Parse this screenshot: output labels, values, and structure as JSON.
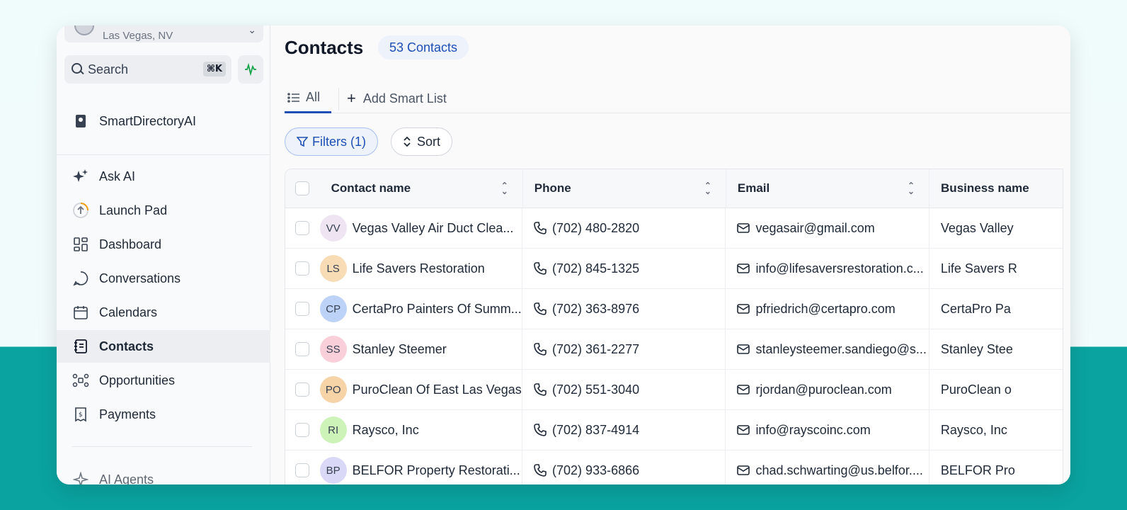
{
  "location": {
    "name": "Las Vegas, NV"
  },
  "search": {
    "label": "Search",
    "shortcut": "⌘K"
  },
  "sidebar": {
    "brand": "SmartDirectoryAI",
    "items": [
      {
        "label": "Ask AI",
        "icon": "sparkles-icon"
      },
      {
        "label": "Launch Pad",
        "icon": "rocket-icon"
      },
      {
        "label": "Dashboard",
        "icon": "grid-icon"
      },
      {
        "label": "Conversations",
        "icon": "chat-icon"
      },
      {
        "label": "Calendars",
        "icon": "calendar-icon"
      },
      {
        "label": "Contacts",
        "icon": "contacts-icon",
        "active": true
      },
      {
        "label": "Opportunities",
        "icon": "funnel-icon"
      },
      {
        "label": "Payments",
        "icon": "invoice-icon"
      }
    ],
    "bottom_item": "AI Agents"
  },
  "header": {
    "title": "Contacts",
    "count_label": "53 Contacts"
  },
  "tabs": {
    "all": "All",
    "add_smart_list": "Add Smart List"
  },
  "toolbar": {
    "filters": "Filters (1)",
    "sort": "Sort"
  },
  "table": {
    "columns": [
      "Contact name",
      "Phone",
      "Email",
      "Business name"
    ],
    "rows": [
      {
        "initials": "VV",
        "avatar_color": "#efe5f2",
        "name": "Vegas Valley Air Duct Clea...",
        "phone": "(702) 480-2820",
        "email": "vegasair@gmail.com",
        "business": "Vegas Valley"
      },
      {
        "initials": "LS",
        "avatar_color": "#f7dcb6",
        "name": "Life Savers Restoration",
        "phone": "(702) 845-1325",
        "email": "info@lifesaversrestoration.c...",
        "business": "Life Savers R"
      },
      {
        "initials": "CP",
        "avatar_color": "#bcd2f7",
        "name": "CertaPro Painters Of Summ...",
        "phone": "(702) 363-8976",
        "email": "pfriedrich@certapro.com",
        "business": "CertaPro Pa"
      },
      {
        "initials": "SS",
        "avatar_color": "#f9cfd9",
        "name": "Stanley Steemer",
        "phone": "(702) 361-2277",
        "email": "stanleysteemer.sandiego@s...",
        "business": "Stanley Stee"
      },
      {
        "initials": "PO",
        "avatar_color": "#f7d3a8",
        "name": "PuroClean Of East Las Vegas",
        "phone": "(702) 551-3040",
        "email": "rjordan@puroclean.com",
        "business": "PuroClean o"
      },
      {
        "initials": "RI",
        "avatar_color": "#cdf3b8",
        "name": "Raysco, Inc",
        "phone": "(702) 837-4914",
        "email": "info@rayscoinc.com",
        "business": "Raysco, Inc"
      },
      {
        "initials": "BP",
        "avatar_color": "#d9d8f7",
        "name": "BELFOR Property Restorati...",
        "phone": "(702) 933-6866",
        "email": "chad.schwarting@us.belfor....",
        "business": "BELFOR Pro"
      }
    ]
  },
  "colors": {
    "accent": "#1e4fb5",
    "teal_background": "#0aa3a0"
  }
}
